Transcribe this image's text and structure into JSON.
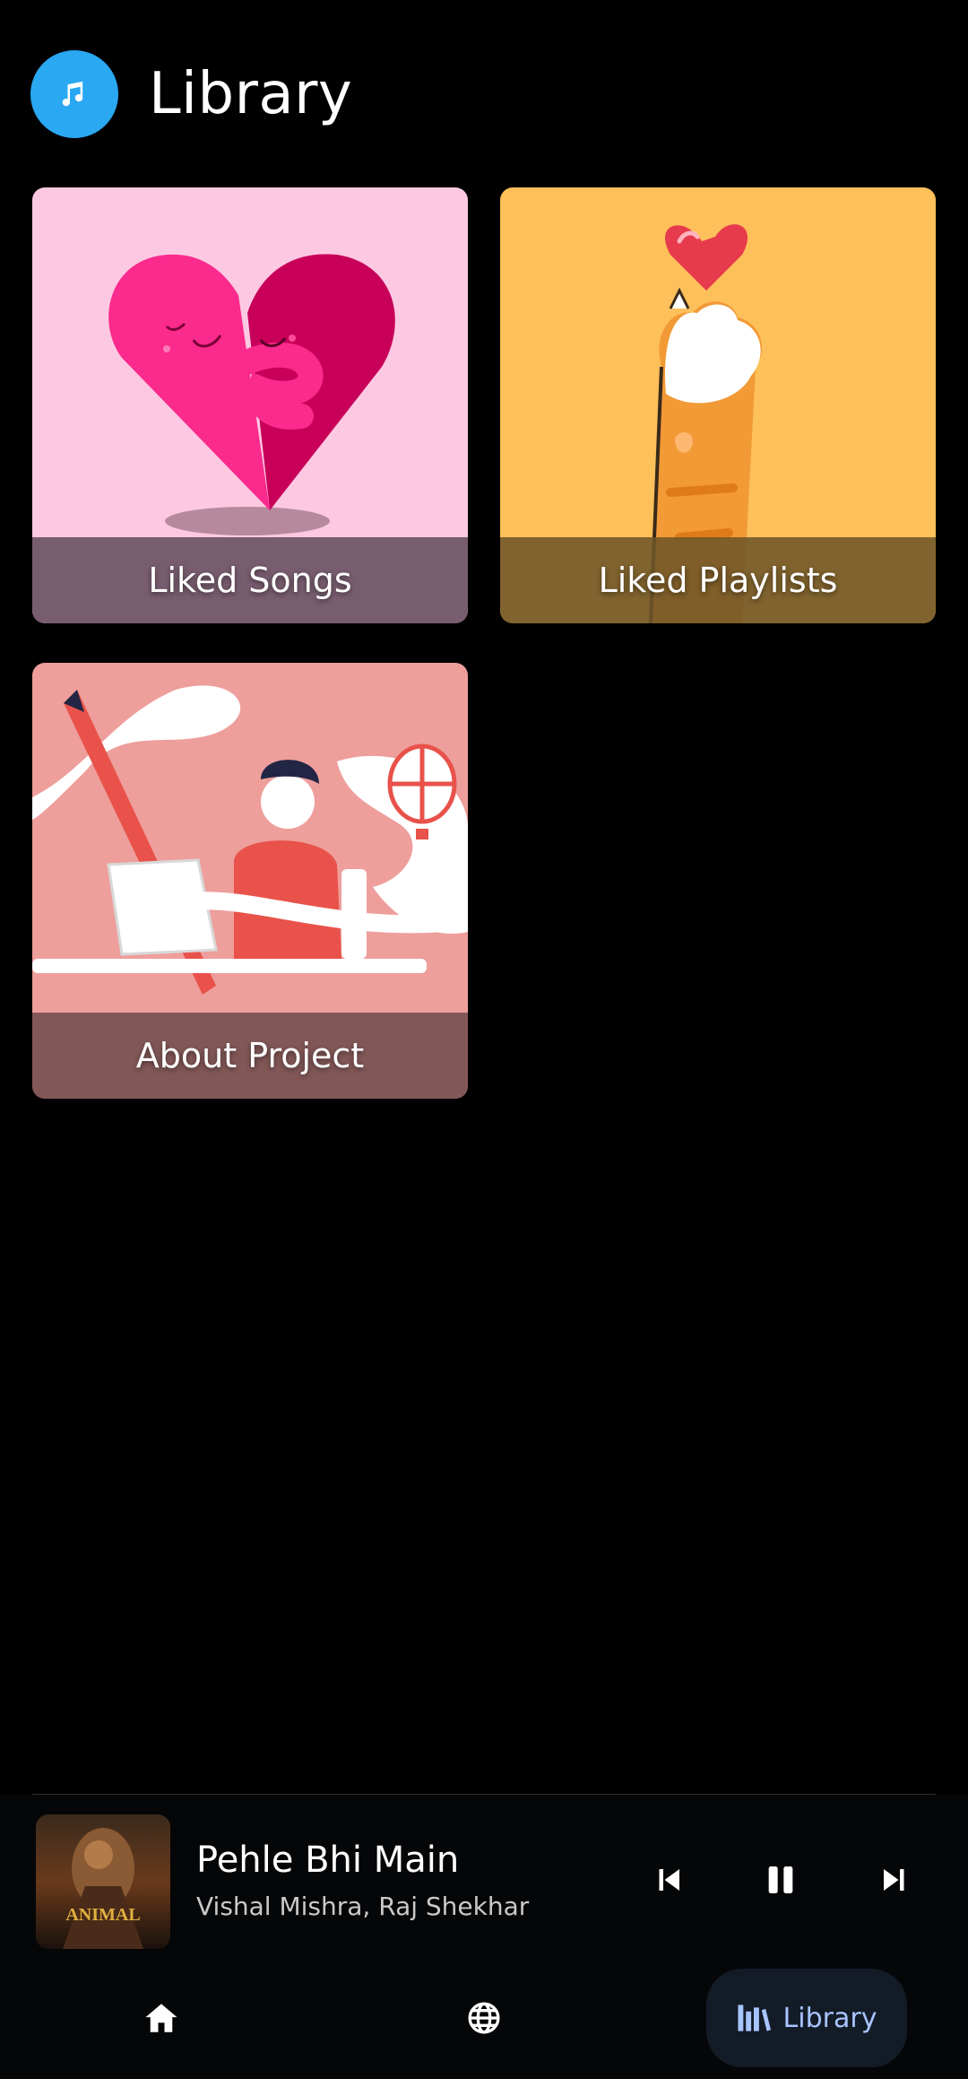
{
  "header": {
    "title": "Library",
    "logo_icon": "music-note-icon"
  },
  "cards": [
    {
      "label": "Liked Songs",
      "bg": "#fdc9e2"
    },
    {
      "label": "Liked Playlists",
      "bg": "#fdc05a"
    },
    {
      "label": "About Project",
      "bg": "#ee9e9b"
    }
  ],
  "player": {
    "title": "Pehle Bhi Main",
    "artist": "Vishal Mishra, Raj Shekhar",
    "album_text": "ANIMAL",
    "controls": [
      "skip-previous-icon",
      "pause-icon",
      "skip-next-icon"
    ]
  },
  "nav": {
    "items": [
      {
        "icon": "home-icon"
      },
      {
        "icon": "globe-icon"
      },
      {
        "icon": "library-icon",
        "label": "Library",
        "active": true
      }
    ],
    "accent": "#a7c4ff"
  },
  "colors": {
    "background": "#000000",
    "logo": "#2aa8f2"
  }
}
